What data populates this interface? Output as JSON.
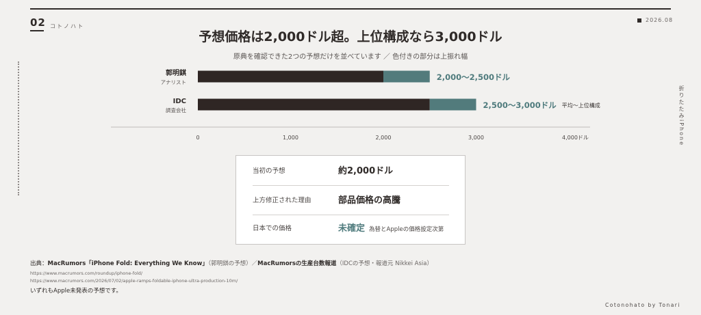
{
  "header": {
    "section_number": "02",
    "section_title": "コトノハト",
    "date": "2026.08",
    "side_label": "折りたたみiPhone"
  },
  "chart_data": {
    "type": "bar",
    "orientation": "horizontal",
    "stacked": true,
    "title": "予想価格は2,000ドル超。上位構成なら3,000ドル",
    "subtitle": "原典を確認できた2つの予想だけを並べています ／ 色付きの部分は上振れ幅",
    "categories": [
      {
        "name": "郭明錤",
        "role": "アナリスト"
      },
      {
        "name": "IDC",
        "role": "調査会社"
      }
    ],
    "ranges": [
      {
        "low": 2000,
        "high": 2500,
        "label": "2,000〜2,500ドル",
        "note": ""
      },
      {
        "low": 2500,
        "high": 3000,
        "label": "2,500〜3,000ドル",
        "note": "平均〜上位構成"
      }
    ],
    "xlim": [
      0,
      4000
    ],
    "x_ticks": [
      {
        "value": 0,
        "label": "0"
      },
      {
        "value": 1000,
        "label": "1,000"
      },
      {
        "value": 2000,
        "label": "2,000"
      },
      {
        "value": 3000,
        "label": "3,000"
      },
      {
        "value": 4000,
        "label": "4,000ドル"
      }
    ],
    "colors": {
      "base": "#2f2624",
      "range": "#527b7c",
      "axis": "#bdbab8",
      "label_range": "#4f7b7d"
    }
  },
  "summary": {
    "rows": [
      {
        "key": "当初の予想",
        "value": "約2,000ドル",
        "note": "",
        "accent": false
      },
      {
        "key": "上方修正された理由",
        "value": "部品価格の高騰",
        "note": "",
        "accent": false
      },
      {
        "key": "日本での価格",
        "value": "未確定",
        "note": "為替とAppleの価格設定次第",
        "accent": true
      }
    ]
  },
  "source": {
    "prefix": "出典：",
    "ref1": "MacRumors「iPhone Fold: Everything We Know」",
    "ref1_note": "（郭明錤の予想）",
    "sep": "／",
    "ref2": "MacRumorsの生産台数報道",
    "ref2_note": "（IDCの予想・報道元 Nikkei Asia）",
    "url1": "https://www.macrumors.com/roundup/iphone-fold/",
    "url2": "https://www.macrumors.com/2026/07/02/apple-ramps-foldable-iphone-ultra-production-10m/",
    "note": "いずれもApple未発表の予想です。"
  },
  "footer": {
    "credit": "Cotonohato by Tonari"
  }
}
